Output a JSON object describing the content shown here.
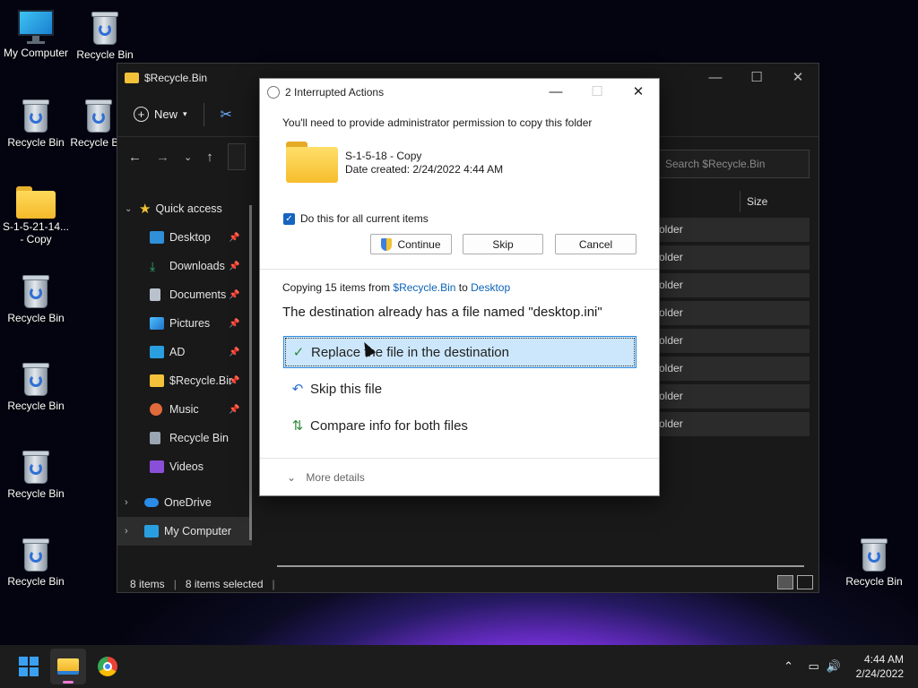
{
  "desktop": {
    "icons": [
      {
        "label": "My Computer",
        "icon": "computer-icon"
      },
      {
        "label": "Recycle Bin",
        "icon": "recycle-bin-icon"
      },
      {
        "label": "Recycle Bin",
        "icon": "recycle-bin-icon"
      },
      {
        "label": "Recycle Bin",
        "icon": "recycle-bin-icon"
      },
      {
        "label": "S-1-5-21-14... - Copy",
        "icon": "folder-icon"
      },
      {
        "label": "Recycle Bin",
        "icon": "recycle-bin-icon"
      },
      {
        "label": "Recycle Bin",
        "icon": "recycle-bin-icon"
      },
      {
        "label": "Recycle Bin",
        "icon": "recycle-bin-icon"
      },
      {
        "label": "Recycle Bin",
        "icon": "recycle-bin-icon"
      },
      {
        "label": "Recycle Bin",
        "icon": "recycle-bin-icon"
      }
    ]
  },
  "explorer": {
    "title": "$Recycle.Bin",
    "toolbar": {
      "new_label": "New"
    },
    "search_placeholder": "Search $Recycle.Bin",
    "column_size": "Size",
    "nav": [
      {
        "label": "Quick access",
        "icon": "star-icon",
        "pinned": false
      },
      {
        "label": "Desktop",
        "icon": "desktop-icon",
        "pinned": true
      },
      {
        "label": "Downloads",
        "icon": "download-icon",
        "pinned": true
      },
      {
        "label": "Documents",
        "icon": "document-icon",
        "pinned": true
      },
      {
        "label": "Pictures",
        "icon": "pictures-icon",
        "pinned": true
      },
      {
        "label": "AD",
        "icon": "monitor-icon",
        "pinned": true
      },
      {
        "label": "$Recycle.Bir",
        "icon": "folder-icon",
        "pinned": true
      },
      {
        "label": "Music",
        "icon": "music-icon",
        "pinned": true
      },
      {
        "label": "Recycle Bin",
        "icon": "recycle-bin-icon",
        "pinned": false
      },
      {
        "label": "Videos",
        "icon": "videos-icon",
        "pinned": false
      },
      {
        "label": "OneDrive",
        "icon": "cloud-icon",
        "pinned": false
      },
      {
        "label": "My Computer",
        "icon": "computer-icon",
        "pinned": false
      }
    ],
    "rows": [
      "older",
      "older",
      "older",
      "older",
      "older",
      "older",
      "older",
      "older"
    ],
    "status": {
      "items": "8 items",
      "selected": "8 items selected"
    }
  },
  "dialog": {
    "title": "2 Interrupted Actions",
    "permission_text": "You'll need to provide administrator permission to copy this folder",
    "file_name": "S-1-5-18 - Copy",
    "file_date": "Date created: 2/24/2022 4:44 AM",
    "checkbox_label": "Do this for all current items",
    "checkbox_checked": true,
    "buttons": {
      "continue": "Continue",
      "skip": "Skip",
      "cancel": "Cancel"
    },
    "copying": {
      "prefix": "Copying 15 items from ",
      "source": "$Recycle.Bin",
      "mid": " to ",
      "dest": "Desktop"
    },
    "conflict_text": "The destination already has a file named \"desktop.ini\"",
    "options": {
      "replace": "Replace the file in the destination",
      "skip": "Skip this file",
      "compare": "Compare info for both files"
    },
    "more_details": "More details"
  },
  "taskbar": {
    "time": "4:44 AM",
    "date": "2/24/2022"
  },
  "colors": {
    "accent": "#0b63b7",
    "selection": "#cce7fb",
    "explorer_bg": "#191919"
  }
}
